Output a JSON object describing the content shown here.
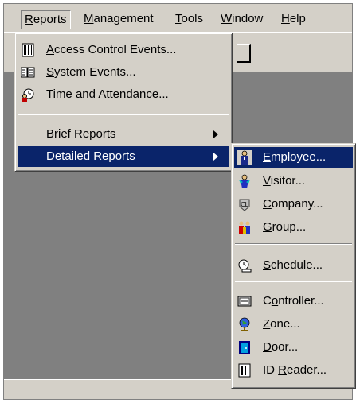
{
  "menubar": {
    "items": [
      {
        "label": "Reports",
        "mnemonic": "R",
        "rest": "eports"
      },
      {
        "label": "Management",
        "mnemonic": "M",
        "rest": "anagement"
      },
      {
        "label": "Tools",
        "mnemonic": "T",
        "rest": "ools"
      },
      {
        "label": "Window",
        "mnemonic": "W",
        "rest": "indow"
      },
      {
        "label": "Help",
        "mnemonic": "H",
        "rest": "elp"
      }
    ]
  },
  "reports_menu": {
    "access_control": {
      "mn": "A",
      "rest": "ccess Control Events..."
    },
    "system_events": {
      "mn": "S",
      "rest": "ystem Events..."
    },
    "time_attendance": {
      "mn": "T",
      "rest": "ime and Attendance..."
    },
    "brief_reports": "Brief Reports",
    "detailed_reports": "Detailed Reports"
  },
  "detailed_submenu": {
    "employee": {
      "mn": "E",
      "rest": "mployee..."
    },
    "visitor": {
      "mn": "V",
      "rest": "isitor..."
    },
    "company": {
      "mn": "C",
      "rest": "ompany..."
    },
    "group": {
      "mn": "G",
      "rest": "roup..."
    },
    "schedule": {
      "mn": "S",
      "rest": "chedule..."
    },
    "controller": {
      "pre": "C",
      "mn": "o",
      "rest": "ntroller..."
    },
    "zone": {
      "mn": "Z",
      "rest": "one..."
    },
    "door": {
      "mn": "D",
      "rest": "oor..."
    },
    "id_reader": {
      "pre": "ID ",
      "mn": "R",
      "rest": "eader..."
    }
  },
  "colors": {
    "face": "#d4d0c8",
    "workspace": "#808080",
    "highlight": "#0a246a"
  },
  "icons": {
    "access_control": "reader-panel-icon",
    "system_events": "system-book-icon",
    "time_attendance": "clock-person-icon",
    "employee": "employee-person-icon",
    "visitor": "visitor-person-icon",
    "company": "company-icon",
    "group": "group-people-icon",
    "schedule": "schedule-clock-icon",
    "controller": "controller-icon",
    "zone": "zone-globe-icon",
    "door": "door-icon",
    "id_reader": "id-reader-icon"
  }
}
